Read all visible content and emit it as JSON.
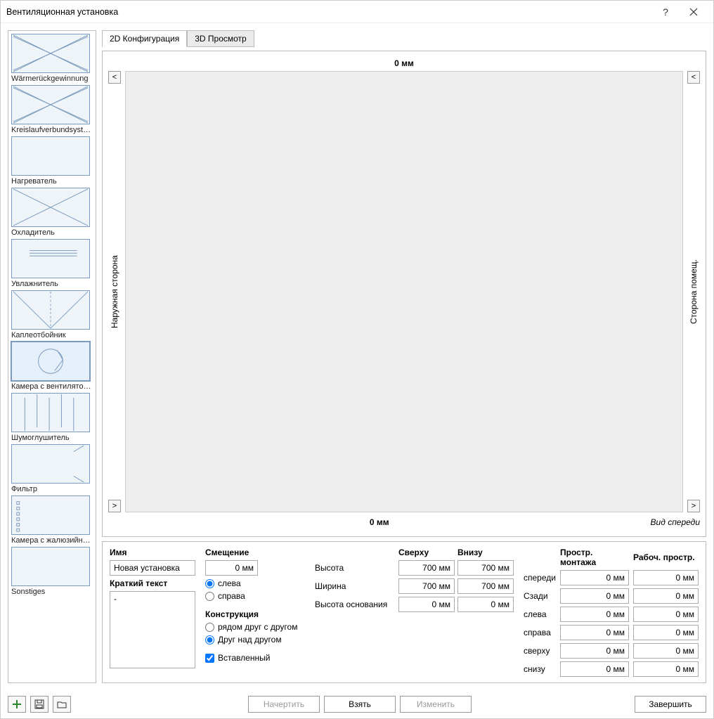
{
  "window": {
    "title": "Вентиляционная установка"
  },
  "components": [
    {
      "label": "Wärmerückgewinnung",
      "icon": "cross2",
      "selected": false
    },
    {
      "label": "Kreislaufverbundsystem",
      "icon": "cross2",
      "selected": false
    },
    {
      "label": "Нагреватель",
      "icon": "blank",
      "selected": false
    },
    {
      "label": "Охладитель",
      "icon": "cross1",
      "selected": false
    },
    {
      "label": "Увлажнитель",
      "icon": "lines",
      "selected": false
    },
    {
      "label": "Каплеотбойник",
      "icon": "chevron",
      "selected": false
    },
    {
      "label": "Камера с вентилятором",
      "icon": "fan",
      "selected": true
    },
    {
      "label": "Шумоглушитель",
      "icon": "silencer",
      "selected": false
    },
    {
      "label": "Фильтр",
      "icon": "filter",
      "selected": false
    },
    {
      "label": "Камера с жалюзийным",
      "icon": "louver",
      "selected": false
    },
    {
      "label": "Sonstiges",
      "icon": "blank",
      "selected": false
    }
  ],
  "tabs": {
    "tab1": "2D Конфигурация",
    "tab2": "3D Просмотр"
  },
  "canvas": {
    "top_label": "0 мм",
    "bottom_label": "0 мм",
    "left_label": "Наружная сторона",
    "right_label": "Сторона помещ.",
    "view_label": "Вид спереди",
    "arrow_left": "<",
    "arrow_right": ">"
  },
  "props": {
    "name_label": "Имя",
    "name_value": "Новая установка",
    "short_text_label": "Краткий текст",
    "short_text_value": "-",
    "offset_label": "Смещение",
    "offset_value": "0 мм",
    "offset_left": "слева",
    "offset_right": "справа",
    "construction_label": "Конструкция",
    "construction_side": "рядом друг с другом",
    "construction_stack": "Друг над другом",
    "inserted_label": "Вставленный",
    "dim_top_header": "Сверху",
    "dim_bottom_header": "Внизу",
    "height_label": "Высота",
    "height_top": "700 мм",
    "height_bot": "700 мм",
    "width_label": "Ширина",
    "width_top": "700 мм",
    "width_bot": "700 мм",
    "base_label": "Высота основания",
    "base_top": "0 мм",
    "base_bot": "0 мм",
    "space_install_header": "Простр. монтажа",
    "space_work_header": "Рабоч. простр.",
    "front_label": "спереди",
    "back_label": "Сзади",
    "left_label": "слева",
    "right_label": "справа",
    "top_label": "сверху",
    "bottom_label": "снизу",
    "val_0": "0 мм"
  },
  "footer": {
    "draw": "Начертить",
    "take": "Взять",
    "modify": "Изменить",
    "finish": "Завершить"
  }
}
